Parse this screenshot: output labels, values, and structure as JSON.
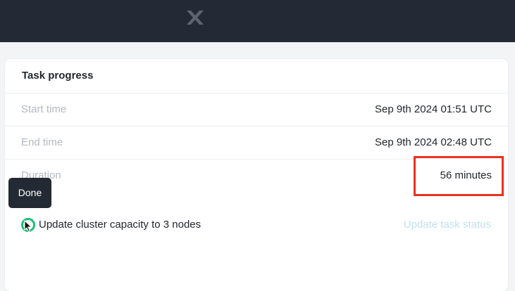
{
  "header": {
    "logo_icon": "x-logo-icon"
  },
  "card": {
    "title": "Task progress",
    "rows": [
      {
        "label": "Start time",
        "value": "Sep 9th 2024 01:51 UTC"
      },
      {
        "label": "End time",
        "value": "Sep 9th 2024 02:48 UTC"
      },
      {
        "label": "Duration",
        "value": "56 minutes"
      }
    ]
  },
  "task": {
    "status_icon": "status-done-icon",
    "label": "Update cluster capacity to 3 nodes",
    "link": "Update task status"
  },
  "tooltip": {
    "text": "Done"
  },
  "colors": {
    "topbar": "#242a35",
    "highlight": "#e8321e",
    "status_done": "#18c27a",
    "link": "#bfe0f2"
  }
}
